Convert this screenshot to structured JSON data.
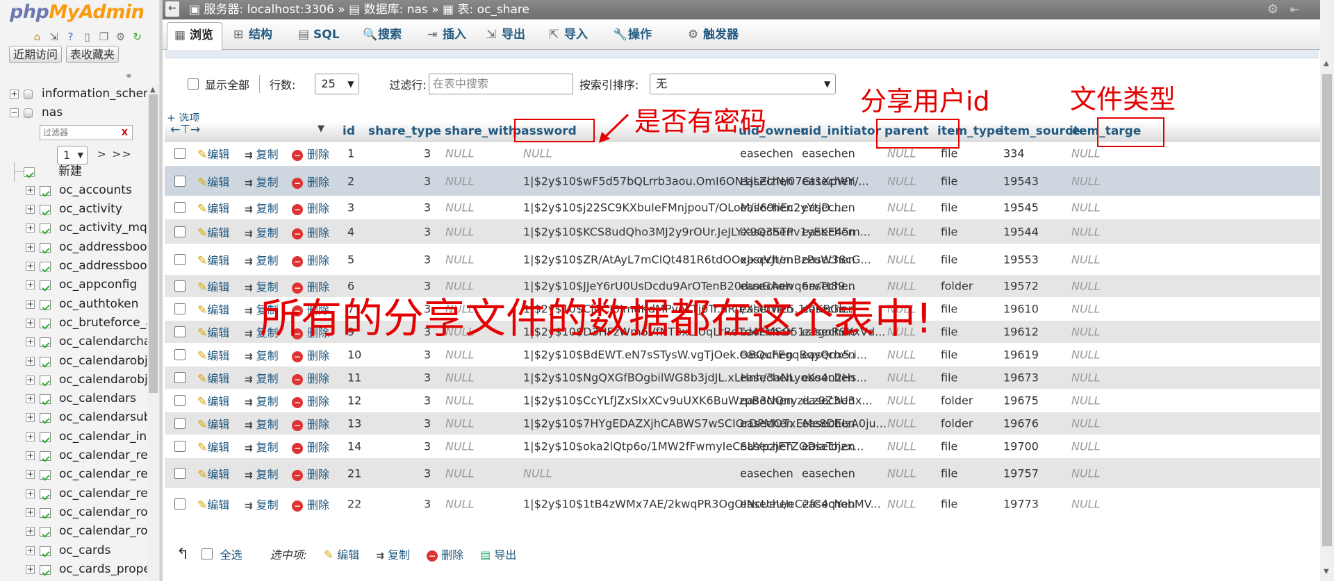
{
  "sidebar": {
    "logo_php": "php",
    "logo_admin": "MyAdmin",
    "tabs": [
      "近期访问",
      "表收藏夹"
    ],
    "filter_placeholder": "过滤器",
    "filter_clear": "X",
    "page_select": "1",
    "page_nav": "> >>",
    "new_label": "新建",
    "databases": [
      "information_schem",
      "nas"
    ],
    "tables": [
      "oc_accounts",
      "oc_activity",
      "oc_activity_mq",
      "oc_addressbook",
      "oc_addressbook",
      "oc_appconfig",
      "oc_authtoken",
      "oc_bruteforce_a",
      "oc_calendarchar",
      "oc_calendarobje",
      "oc_calendarobje",
      "oc_calendars",
      "oc_calendarsubs",
      "oc_calendar_inv",
      "oc_calendar_ren",
      "oc_calendar_res",
      "oc_calendar_res",
      "oc_calendar_roc",
      "oc_calendar_roc",
      "oc_cards",
      "oc_cards_proper"
    ]
  },
  "topbar": {
    "server": "服务器: localhost:3306",
    "sep1": "»",
    "database": "数据库: nas",
    "sep2": "»",
    "table": "表: oc_share"
  },
  "menu": [
    {
      "label": "浏览",
      "icon": "▦"
    },
    {
      "label": "结构",
      "icon": "⊞"
    },
    {
      "label": "SQL",
      "icon": "▤"
    },
    {
      "label": "搜索",
      "icon": "🔍"
    },
    {
      "label": "插入",
      "icon": "⇥"
    },
    {
      "label": "导出",
      "icon": "⇲"
    },
    {
      "label": "导入",
      "icon": "⇱"
    },
    {
      "label": "操作",
      "icon": "🔧"
    },
    {
      "label": "触发器",
      "icon": "⚙"
    }
  ],
  "controls": {
    "show_all": "显示全部",
    "rows_label": "行数:",
    "rows_value": "25",
    "filter_label": "过滤行:",
    "filter_placeholder": "在表中搜索",
    "sort_label": "按索引排序:",
    "sort_value": "无",
    "options_link": "+ 选项"
  },
  "columns": [
    "id",
    "share_type",
    "share_with",
    "password",
    "uid_owner",
    "uid_initiator",
    "parent",
    "item_type",
    "item_source",
    "item_targe"
  ],
  "actions": {
    "edit": "编辑",
    "copy": "复制",
    "delete": "删除"
  },
  "rows": [
    {
      "id": "1",
      "share_type": "3",
      "share_with": "NULL",
      "password": "NULL",
      "uid_owner": "easechen",
      "uid_initiator": "easechen",
      "parent": "NULL",
      "item_type": "file",
      "item_source": "334",
      "item_target": "NULL"
    },
    {
      "id": "2",
      "share_type": "3",
      "share_with": "NULL",
      "password": "1|$2y$10$wF5d57bQLrrb3aou.OmI6ON1jLZlzN/07Gt1XpWY/...",
      "uid_owner": "easechen",
      "uid_initiator": "easechen",
      "parent": "NULL",
      "item_type": "file",
      "item_source": "19543",
      "item_target": "NULL"
    },
    {
      "id": "3",
      "share_type": "3",
      "share_with": "NULL",
      "password": "1|$2y$10$j22SC9KXbuIeFMnjpouT/OLoM/il69IiEc2yYtjD....",
      "uid_owner": "easechen",
      "uid_initiator": "easechen",
      "parent": "NULL",
      "item_type": "file",
      "item_source": "19545",
      "item_target": "NULL"
    },
    {
      "id": "4",
      "share_type": "3",
      "share_with": "NULL",
      "password": "1|$2y$10$KCS8udQho3MJ2y9rOUr.JeJLYX9Q3STPv1yEKE45m...",
      "uid_owner": "easechen",
      "uid_initiator": "easechen",
      "parent": "NULL",
      "item_type": "file",
      "item_source": "19544",
      "item_target": "NULL"
    },
    {
      "id": "5",
      "share_type": "3",
      "share_with": "NULL",
      "password": "1|$2y$10$ZR/AtAyL7mClQt481R6tdOOxJxqVJt/mBzPuW38cG...",
      "uid_owner": "easechen",
      "uid_initiator": "easechen",
      "parent": "NULL",
      "item_type": "file",
      "item_source": "19553",
      "item_target": "NULL"
    },
    {
      "id": "6",
      "share_type": "3",
      "share_with": "NULL",
      "password": "1|$2y$10$JJeY6rU0UsDcdu9ArOTenB20duxGAolvq6rvTt89...",
      "uid_owner": "easechen",
      "uid_initiator": "easechen",
      "parent": "NULL",
      "item_type": "folder",
      "item_source": "19572",
      "item_target": "NULL"
    },
    {
      "id": "7",
      "share_type": "3",
      "share_with": "NULL",
      "password": "1|$2y$10$CjCCJ0ImdKdMPvoKTj0Tr.uRu/XhIhvI25.1I0KBGb...",
      "uid_owner": "easechen",
      "uid_initiator": "easechen",
      "parent": "NULL",
      "item_type": "file",
      "item_source": "19610",
      "item_target": "NULL"
    },
    {
      "id": "9",
      "share_type": "3",
      "share_with": "NULL",
      "password": "1|$2y$10$D3HFzWm6VfNT3xLIUqLrReTd4FMSO51z3goRSKxVd...",
      "uid_owner": "easechen",
      "uid_initiator": "easechen",
      "parent": "NULL",
      "item_type": "file",
      "item_source": "19612",
      "item_target": "NULL"
    },
    {
      "id": "10",
      "share_type": "3",
      "share_with": "NULL",
      "password": "1|$2y$10$BdEWT.eN7sSTysW.vgTjOek.OBQuFEgqBqyQnx5.i...",
      "uid_owner": "easechen",
      "uid_initiator": "easechen",
      "parent": "NULL",
      "item_type": "file",
      "item_source": "19619",
      "item_target": "NULL"
    },
    {
      "id": "11",
      "share_type": "3",
      "share_with": "NULL",
      "password": "1|$2y$10$NgQXGfBOgbilWG8b3jdJL.xLHnh/3aNLyoKo4n2Hs...",
      "uid_owner": "easechen",
      "uid_initiator": "easechen",
      "parent": "NULL",
      "item_type": "file",
      "item_source": "19673",
      "item_target": "NULL"
    },
    {
      "id": "12",
      "share_type": "3",
      "share_with": "NULL",
      "password": "1|$2y$10$CcYLfJZxSlxXCv9uUXK6BuWzpB3NQnyziLz9Z3U3x...",
      "uid_owner": "easechen",
      "uid_initiator": "easechen",
      "parent": "NULL",
      "item_type": "folder",
      "item_source": "19675",
      "item_target": "NULL"
    },
    {
      "id": "13",
      "share_type": "3",
      "share_with": "NULL",
      "password": "1|$2y$10$7HYgEDAZXjhCABWS7wSCIOrDPMOTxEMe8DEIzA0ju...",
      "uid_owner": "easechen",
      "uid_initiator": "easechen",
      "parent": "NULL",
      "item_type": "folder",
      "item_source": "19676",
      "item_target": "NULL"
    },
    {
      "id": "14",
      "share_type": "3",
      "share_with": "NULL",
      "password": "1|$2y$10$oka2lQtp6o/1MW2fFwmyIeCSUYpzjFTZODiaTojzx...",
      "uid_owner": "easechen",
      "uid_initiator": "easechen",
      "parent": "NULL",
      "item_type": "file",
      "item_source": "19700",
      "item_target": "NULL"
    },
    {
      "id": "21",
      "share_type": "3",
      "share_with": "NULL",
      "password": "NULL",
      "uid_owner": "easechen",
      "uid_initiator": "easechen",
      "parent": "NULL",
      "item_type": "file",
      "item_source": "19757",
      "item_target": "NULL"
    },
    {
      "id": "22",
      "share_type": "3",
      "share_with": "NULL",
      "password": "1|$2y$10$1tB4zWMx7AE/2kwqPR3OgOINcUeU/eC2fC4qYobMV...",
      "uid_owner": "easechen",
      "uid_initiator": "easechen",
      "parent": "NULL",
      "item_type": "file",
      "item_source": "19773",
      "item_target": "NULL"
    }
  ],
  "footer": {
    "select_all": "全选",
    "with_selected": "选中项:",
    "edit": "编辑",
    "copy": "复制",
    "delete": "删除",
    "export": "导出"
  },
  "annotations": {
    "password": "是否有密码",
    "uid_owner": "分享用户id",
    "item_type": "文件类型",
    "main": "所有的分享文件的数据都在这个表中!"
  },
  "colors": {
    "annotation": "#e40000",
    "link": "#235a81",
    "highlight_row": "#ced6df"
  }
}
